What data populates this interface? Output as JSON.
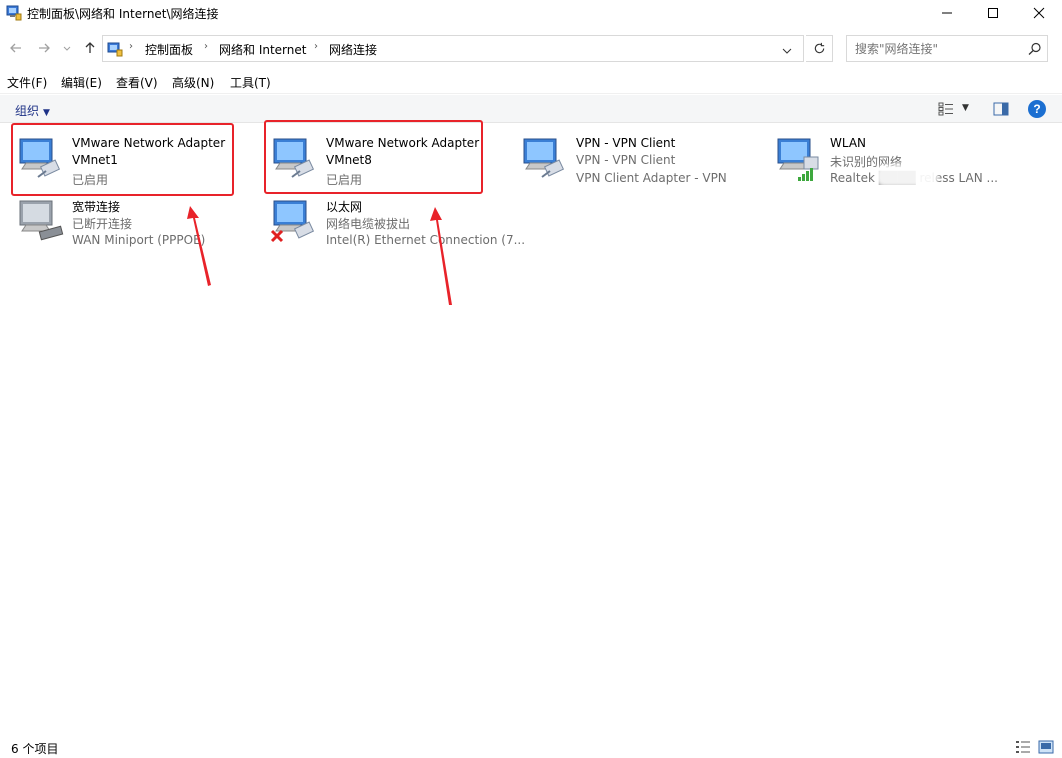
{
  "window": {
    "title": "控制面板\\网络和 Internet\\网络连接"
  },
  "address": {
    "crumbs": [
      "控制面板",
      "网络和 Internet",
      "网络连接"
    ]
  },
  "search": {
    "placeholder": "搜索\"网络连接\""
  },
  "menu": {
    "items": [
      "文件(F)",
      "编辑(E)",
      "查看(V)",
      "高级(N)",
      "工具(T)"
    ]
  },
  "toolbar": {
    "organize_label": "组织"
  },
  "connections": [
    {
      "name": "VMware Network Adapter VMnet1",
      "line1": "VMware Network Adapter",
      "line2": "VMnet1",
      "line3": "已启用",
      "icon": "network-adapter-icon",
      "highlighted": true
    },
    {
      "name": "VMware Network Adapter VMnet8",
      "line1": "VMware Network Adapter",
      "line2": "VMnet8",
      "line3": "已启用",
      "icon": "network-adapter-icon",
      "highlighted": true
    },
    {
      "name": "VPN - VPN Client",
      "line1": "VPN - VPN Client",
      "line2": "VPN - VPN Client",
      "line3": "VPN Client Adapter - VPN",
      "icon": "network-adapter-icon"
    },
    {
      "name": "WLAN",
      "line1": "WLAN",
      "line2": "未识别的网络",
      "line3": "Realtek ████ reless LAN ...",
      "icon": "wifi-adapter-icon"
    },
    {
      "name": "宽带连接",
      "line1": "宽带连接",
      "line2": "已断开连接",
      "line3": "WAN Miniport (PPPOE)",
      "icon": "broadband-icon"
    },
    {
      "name": "以太网",
      "line1": "以太网",
      "line2": "网络电缆被拔出",
      "line3": "Intel(R) Ethernet Connection (7...",
      "icon": "ethernet-disconnected-icon"
    }
  ],
  "status": {
    "item_count": "6 个项目"
  },
  "colors": {
    "highlight": "#e8232a",
    "accent": "#1c6fd1",
    "secondary_text": "#6d6d6d"
  }
}
